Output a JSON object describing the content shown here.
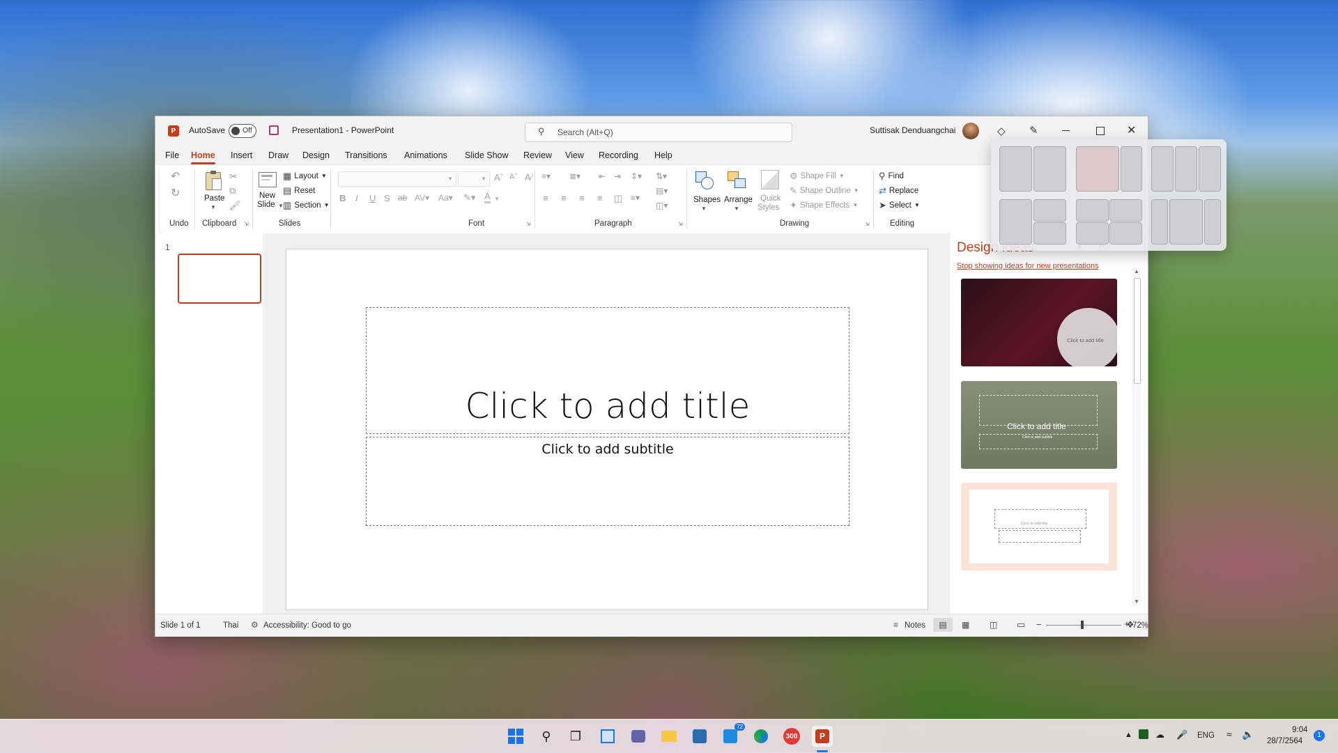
{
  "window": {
    "autosave_label": "AutoSave",
    "autosave_state": "Off",
    "doc_title": "Presentation1  -  PowerPoint",
    "search_placeholder": "Search (Alt+Q)",
    "user_name": "Suttisak Denduangchai"
  },
  "menu": {
    "items": [
      "File",
      "Home",
      "Insert",
      "Draw",
      "Design",
      "Transitions",
      "Animations",
      "Slide Show",
      "Review",
      "View",
      "Recording",
      "Help"
    ],
    "active": "Home"
  },
  "ribbon": {
    "groups": {
      "undo": "Undo",
      "clipboard": "Clipboard",
      "slides": "Slides",
      "font": "Font",
      "paragraph": "Paragraph",
      "drawing": "Drawing",
      "editing": "Editing"
    },
    "paste": "Paste",
    "new_slide": [
      "New",
      "Slide"
    ],
    "layout": "Layout",
    "reset": "Reset",
    "section": "Section",
    "shapes": "Shapes",
    "arrange": "Arrange",
    "quick_styles": [
      "Quick",
      "Styles"
    ],
    "shape_fill": "Shape Fill",
    "shape_outline": "Shape Outline",
    "shape_effects": "Shape Effects",
    "find": "Find",
    "replace": "Replace",
    "select": "Select"
  },
  "slides_pane": {
    "slide_number": "1"
  },
  "slide": {
    "title_placeholder": "Click to add title",
    "subtitle_placeholder": "Click to add subtitle"
  },
  "design_ideas": {
    "title": "Design Ideas",
    "stop_link": "Stop showing ideas for new presentations",
    "card1_title": "Click to add title",
    "card2_title": "Click to add title",
    "card2_sub": "Click to add subtitle",
    "card3_title": "Click to add title"
  },
  "status": {
    "slide_info": "Slide 1 of 1",
    "language": "Thai",
    "accessibility": "Accessibility: Good to go",
    "notes": "Notes",
    "zoom": "72%"
  },
  "taskbar": {
    "store_badge": "72",
    "app_badge": "300",
    "lang": "ENG",
    "time": "9:04",
    "date": "28/7/2564",
    "notif_count": "1"
  },
  "colors": {
    "accent": "#c43e1c",
    "ribbon_bg": "#ffffff",
    "titlebar_bg": "#f3f3f3"
  }
}
